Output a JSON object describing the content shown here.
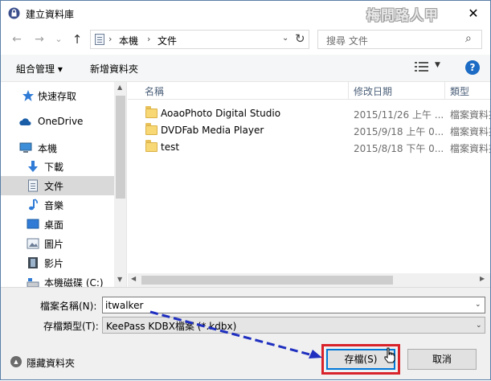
{
  "window": {
    "title": "建立資料庫",
    "watermark": "梅問路人甲",
    "close_glyph": "✕"
  },
  "nav": {
    "back_glyph": "←",
    "forward_glyph": "→",
    "recent_glyph": "⌄",
    "up_glyph": "↑",
    "breadcrumb": [
      "本機",
      "文件"
    ],
    "crumb_sep": "›",
    "address_drop": "⌄",
    "refresh_glyph": "↻",
    "search_placeholder": "搜尋 文件",
    "search_glyph": "⌕"
  },
  "toolbar": {
    "organize_label": "組合管理 ▾",
    "new_folder_label": "新增資料夾",
    "view_drop": "▼",
    "help_label": "?"
  },
  "sidebar": {
    "items": [
      {
        "label": "快速存取",
        "icon": "star-icon"
      },
      {
        "label": "OneDrive",
        "icon": "cloud-icon"
      },
      {
        "label": "本機",
        "icon": "computer-icon"
      },
      {
        "label": "下載",
        "icon": "download-icon"
      },
      {
        "label": "文件",
        "icon": "document-icon",
        "selected": true
      },
      {
        "label": "音樂",
        "icon": "music-icon"
      },
      {
        "label": "桌面",
        "icon": "desktop-icon"
      },
      {
        "label": "圖片",
        "icon": "pictures-icon"
      },
      {
        "label": "影片",
        "icon": "video-icon"
      },
      {
        "label": "本機磁碟 (C:)",
        "icon": "drive-icon"
      }
    ],
    "scroll_up": "▲",
    "scroll_down": "▼"
  },
  "files": {
    "columns": [
      "名稱",
      "修改日期",
      "類型"
    ],
    "sort_glyph": "^",
    "rows": [
      {
        "name": "AoaoPhoto Digital Studio",
        "date": "2015/11/26 上午 ...",
        "type": "檔案資料夾"
      },
      {
        "name": "DVDFab Media Player",
        "date": "2015/9/18 上午 0...",
        "type": "檔案資料夾"
      },
      {
        "name": "test",
        "date": "2015/8/18 下午 0...",
        "type": "檔案資料夾"
      }
    ],
    "scroll_left": "◀",
    "scroll_right": "▶"
  },
  "form": {
    "filename_label": "檔案名稱(N):",
    "filename_value": "itwalker",
    "filetype_label": "存檔類型(T):",
    "filetype_value": "KeePass KDBX檔案 (*.kdbx)",
    "drop_glyph": "⌄",
    "hide_folders_label": "隱藏資料夾",
    "hide_glyph": "▲",
    "save_label": "存檔(S)",
    "cancel_label": "取消"
  },
  "colors": {
    "accent": "#0078d7",
    "annotation_red": "#d9232b",
    "annotation_arrow": "#1f2fbf"
  }
}
